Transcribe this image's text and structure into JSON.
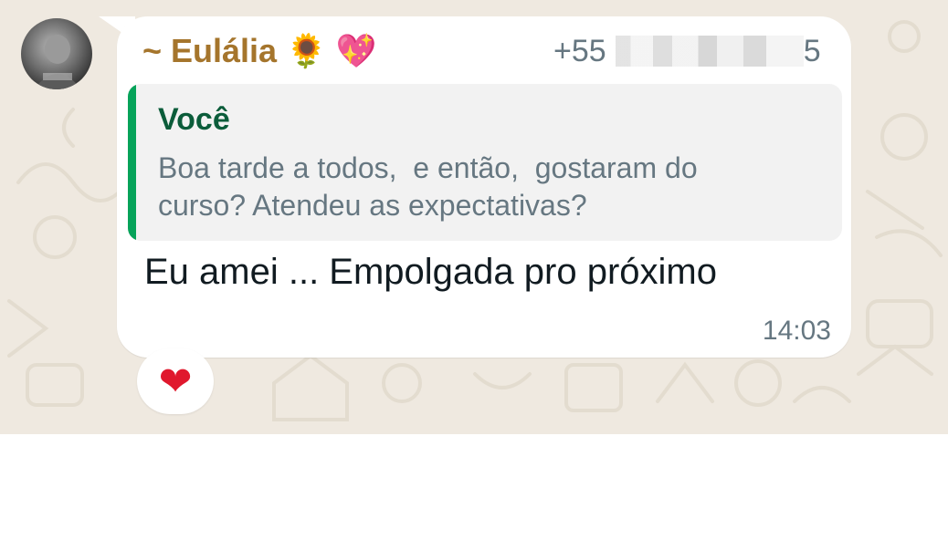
{
  "message": {
    "sender_name": "~ Eulália",
    "sender_emojis": [
      "🌻",
      "💖"
    ],
    "sender_phone_prefix": "+55",
    "sender_phone_suffix": "5",
    "quoted": {
      "author": "Você",
      "text": "Boa tarde a todos,  e então,  gostaram do\ncurso? Atendeu as expectativas?"
    },
    "text": "Eu amei ... Empolgada pro próximo",
    "time": "14:03",
    "reaction": "❤"
  },
  "colors": {
    "background": "#efe9e0",
    "sender_name": "#a5752c",
    "quote_bar": "#06a35a",
    "quote_author": "#0b5c3a",
    "secondary_text": "#667781",
    "reaction": "#e0182d"
  }
}
